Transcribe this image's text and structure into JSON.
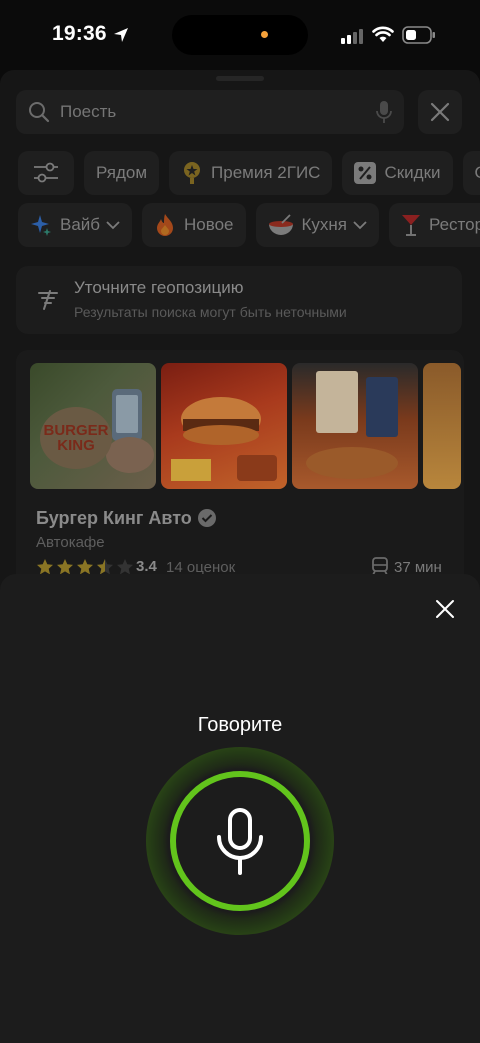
{
  "status_bar": {
    "time": "19:36"
  },
  "search": {
    "placeholder": "Поесть"
  },
  "filters_row1": [
    {
      "label": "",
      "icon": "filter-sliders-icon"
    },
    {
      "label": "Рядом",
      "icon": ""
    },
    {
      "label": "Премия 2ГИС",
      "icon": "award-icon"
    },
    {
      "label": "Скидки",
      "icon": "percent-icon"
    },
    {
      "label": "От",
      "icon": ""
    }
  ],
  "filters_row2": [
    {
      "label": "Вайб",
      "icon": "sparkle-icon",
      "dropdown": true
    },
    {
      "label": "Новое",
      "icon": "fire-icon",
      "dropdown": false
    },
    {
      "label": "Кухня",
      "icon": "bowl-icon",
      "dropdown": true
    },
    {
      "label": "Рестораны",
      "icon": "cocktail-icon",
      "dropdown": false
    }
  ],
  "geo_notice": {
    "title": "Уточните геопозицию",
    "subtitle": "Результаты поиска могут быть неточными"
  },
  "result": {
    "logo_line1": "BURGER",
    "logo_line2": "KING",
    "name": "Бургер Кинг Авто",
    "type": "Автокафе",
    "rating": "3.4",
    "rating_value": 3.4,
    "reviews": "14 оценок",
    "travel_time": "37 мин"
  },
  "voice": {
    "prompt": "Говорите"
  },
  "colors": {
    "accent_green": "#62c41c",
    "star_yellow": "#8a7524"
  }
}
